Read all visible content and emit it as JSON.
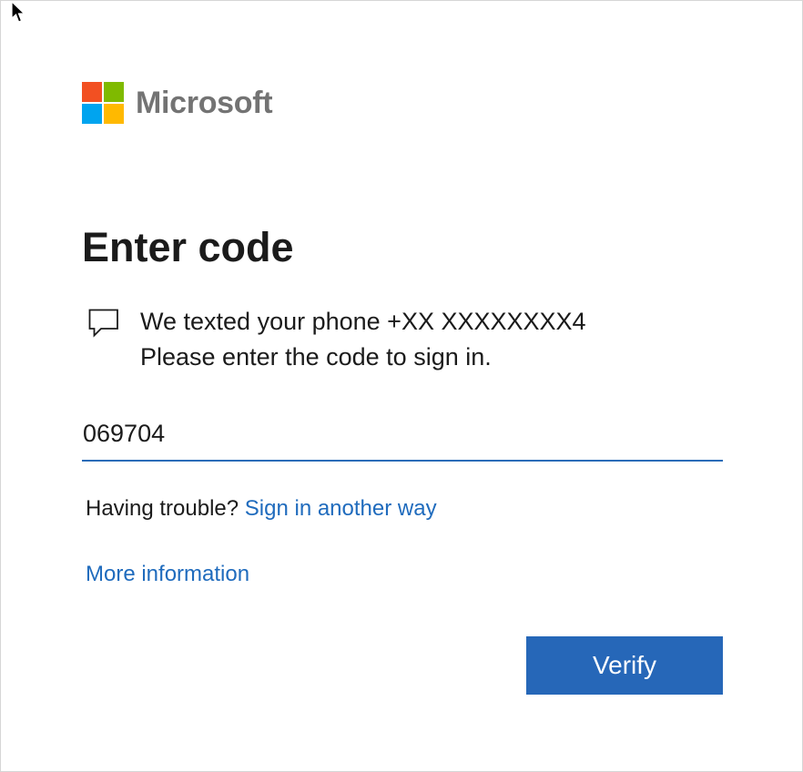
{
  "brand": {
    "name": "Microsoft",
    "logo_colors": [
      "#f25022",
      "#7fba00",
      "#00a4ef",
      "#ffb900"
    ]
  },
  "page": {
    "title": "Enter code",
    "message_line1": "We texted your phone +XX XXXXXXXX4",
    "message_line2": "Please enter the code to sign in."
  },
  "code_field": {
    "value": "069704"
  },
  "trouble": {
    "prefix": "Having trouble?",
    "link": "Sign in another way"
  },
  "more_info_link": "More information",
  "verify_button": "Verify",
  "icons": {
    "cursor": "mouse-pointer-icon",
    "sms": "speech-bubble-icon"
  },
  "colors": {
    "accent": "#2667b8",
    "link": "#1f6bbd"
  }
}
